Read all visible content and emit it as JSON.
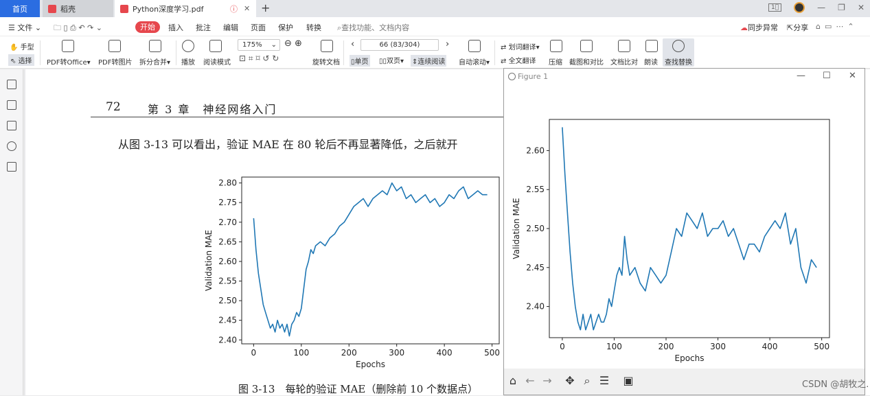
{
  "tabs": {
    "home": "首页",
    "docer": "稻壳",
    "pdf": "Python深度学习.pdf"
  },
  "menu": {
    "file": "文件",
    "start": "开始",
    "items": [
      "插入",
      "批注",
      "编辑",
      "页面",
      "保护",
      "转换"
    ],
    "search_placeholder": "查找功能、文档内容",
    "sync": "同步异常",
    "share": "分享"
  },
  "toolbar": {
    "hand": "手型",
    "select": "选择",
    "pdf_office": "PDF转Office",
    "pdf_image": "PDF转图片",
    "split_merge": "拆分合并",
    "play": "播放",
    "read_mode": "阅读模式",
    "zoom": "175%",
    "rotate_doc": "旋转文档",
    "page": "66 (83/304)",
    "single": "单页",
    "double": "双页",
    "continuous": "连续阅读",
    "auto_scroll": "自动滚动",
    "word_translate": "划词翻译",
    "full_translate": "全文翻译",
    "compress": "压缩",
    "screenshot_compare": "截图和对比",
    "text_compare": "文档比对",
    "read_aloud": "朗读",
    "find_replace": "查找替换"
  },
  "document": {
    "page_number": "72",
    "chapter": "第 3 章　神经网络入门",
    "text": "从图 3-13 可以看出，验证 MAE 在 80 轮后不再显著降低，之后就开",
    "caption": "图 3-13　每轮的验证 MAE（删除前 10 个数据点）"
  },
  "figure_window": {
    "title": "Figure 1"
  },
  "watermark": "CSDN @胡牧之.",
  "chart_data": [
    {
      "type": "line",
      "xlabel": "Epochs",
      "ylabel": "Validation MAE",
      "xlim": [
        -25,
        515
      ],
      "ylim": [
        2.39,
        2.815
      ],
      "xticks": [
        0,
        100,
        200,
        300,
        400,
        500
      ],
      "yticks": [
        2.4,
        2.45,
        2.5,
        2.55,
        2.6,
        2.65,
        2.7,
        2.75,
        2.8
      ],
      "ytick_labels": [
        "2.40",
        "2.45",
        "2.50",
        "2.55",
        "2.60",
        "2.65",
        "2.70",
        "2.75",
        "2.80"
      ],
      "color": "#1f77b4",
      "series": [
        {
          "x": [
            0,
            5,
            10,
            15,
            20,
            25,
            30,
            35,
            40,
            45,
            50,
            55,
            60,
            65,
            70,
            75,
            80,
            85,
            90,
            95,
            100,
            105,
            110,
            115,
            120,
            125,
            130,
            140,
            150,
            160,
            170,
            180,
            190,
            200,
            210,
            220,
            230,
            240,
            250,
            260,
            270,
            280,
            290,
            300,
            310,
            320,
            330,
            340,
            350,
            360,
            370,
            380,
            390,
            400,
            410,
            420,
            430,
            440,
            450,
            460,
            470,
            480,
            490
          ],
          "y": [
            2.71,
            2.63,
            2.57,
            2.53,
            2.49,
            2.47,
            2.45,
            2.43,
            2.44,
            2.42,
            2.45,
            2.43,
            2.44,
            2.42,
            2.44,
            2.41,
            2.44,
            2.45,
            2.47,
            2.46,
            2.48,
            2.53,
            2.58,
            2.6,
            2.63,
            2.62,
            2.64,
            2.65,
            2.64,
            2.66,
            2.67,
            2.69,
            2.7,
            2.72,
            2.74,
            2.75,
            2.76,
            2.74,
            2.76,
            2.77,
            2.78,
            2.77,
            2.8,
            2.78,
            2.79,
            2.76,
            2.77,
            2.75,
            2.76,
            2.77,
            2.75,
            2.76,
            2.74,
            2.75,
            2.77,
            2.76,
            2.78,
            2.79,
            2.76,
            2.77,
            2.78,
            2.77,
            2.77
          ]
        }
      ]
    },
    {
      "type": "line",
      "xlabel": "Epochs",
      "ylabel": "Validation MAE",
      "xlim": [
        -25,
        515
      ],
      "ylim": [
        2.36,
        2.64
      ],
      "xticks": [
        0,
        100,
        200,
        300,
        400,
        500
      ],
      "yticks": [
        2.4,
        2.45,
        2.5,
        2.55,
        2.6
      ],
      "ytick_labels": [
        "2.40",
        "2.45",
        "2.50",
        "2.55",
        "2.60"
      ],
      "color": "#1f77b4",
      "series": [
        {
          "x": [
            0,
            5,
            10,
            15,
            20,
            25,
            30,
            35,
            40,
            45,
            50,
            55,
            60,
            65,
            70,
            75,
            80,
            85,
            90,
            95,
            100,
            105,
            110,
            115,
            120,
            125,
            130,
            140,
            150,
            160,
            170,
            180,
            190,
            200,
            210,
            220,
            230,
            240,
            250,
            260,
            270,
            280,
            290,
            300,
            310,
            320,
            330,
            340,
            350,
            360,
            370,
            380,
            390,
            400,
            410,
            420,
            430,
            440,
            450,
            460,
            470,
            480,
            490
          ],
          "y": [
            2.63,
            2.57,
            2.52,
            2.47,
            2.43,
            2.4,
            2.38,
            2.37,
            2.39,
            2.37,
            2.38,
            2.39,
            2.37,
            2.38,
            2.39,
            2.38,
            2.38,
            2.39,
            2.41,
            2.4,
            2.42,
            2.44,
            2.45,
            2.44,
            2.49,
            2.46,
            2.44,
            2.45,
            2.43,
            2.42,
            2.45,
            2.44,
            2.43,
            2.44,
            2.47,
            2.5,
            2.49,
            2.52,
            2.51,
            2.5,
            2.52,
            2.49,
            2.5,
            2.5,
            2.51,
            2.49,
            2.5,
            2.48,
            2.46,
            2.48,
            2.48,
            2.47,
            2.49,
            2.5,
            2.51,
            2.5,
            2.52,
            2.48,
            2.5,
            2.45,
            2.43,
            2.46,
            2.45
          ]
        }
      ]
    }
  ]
}
